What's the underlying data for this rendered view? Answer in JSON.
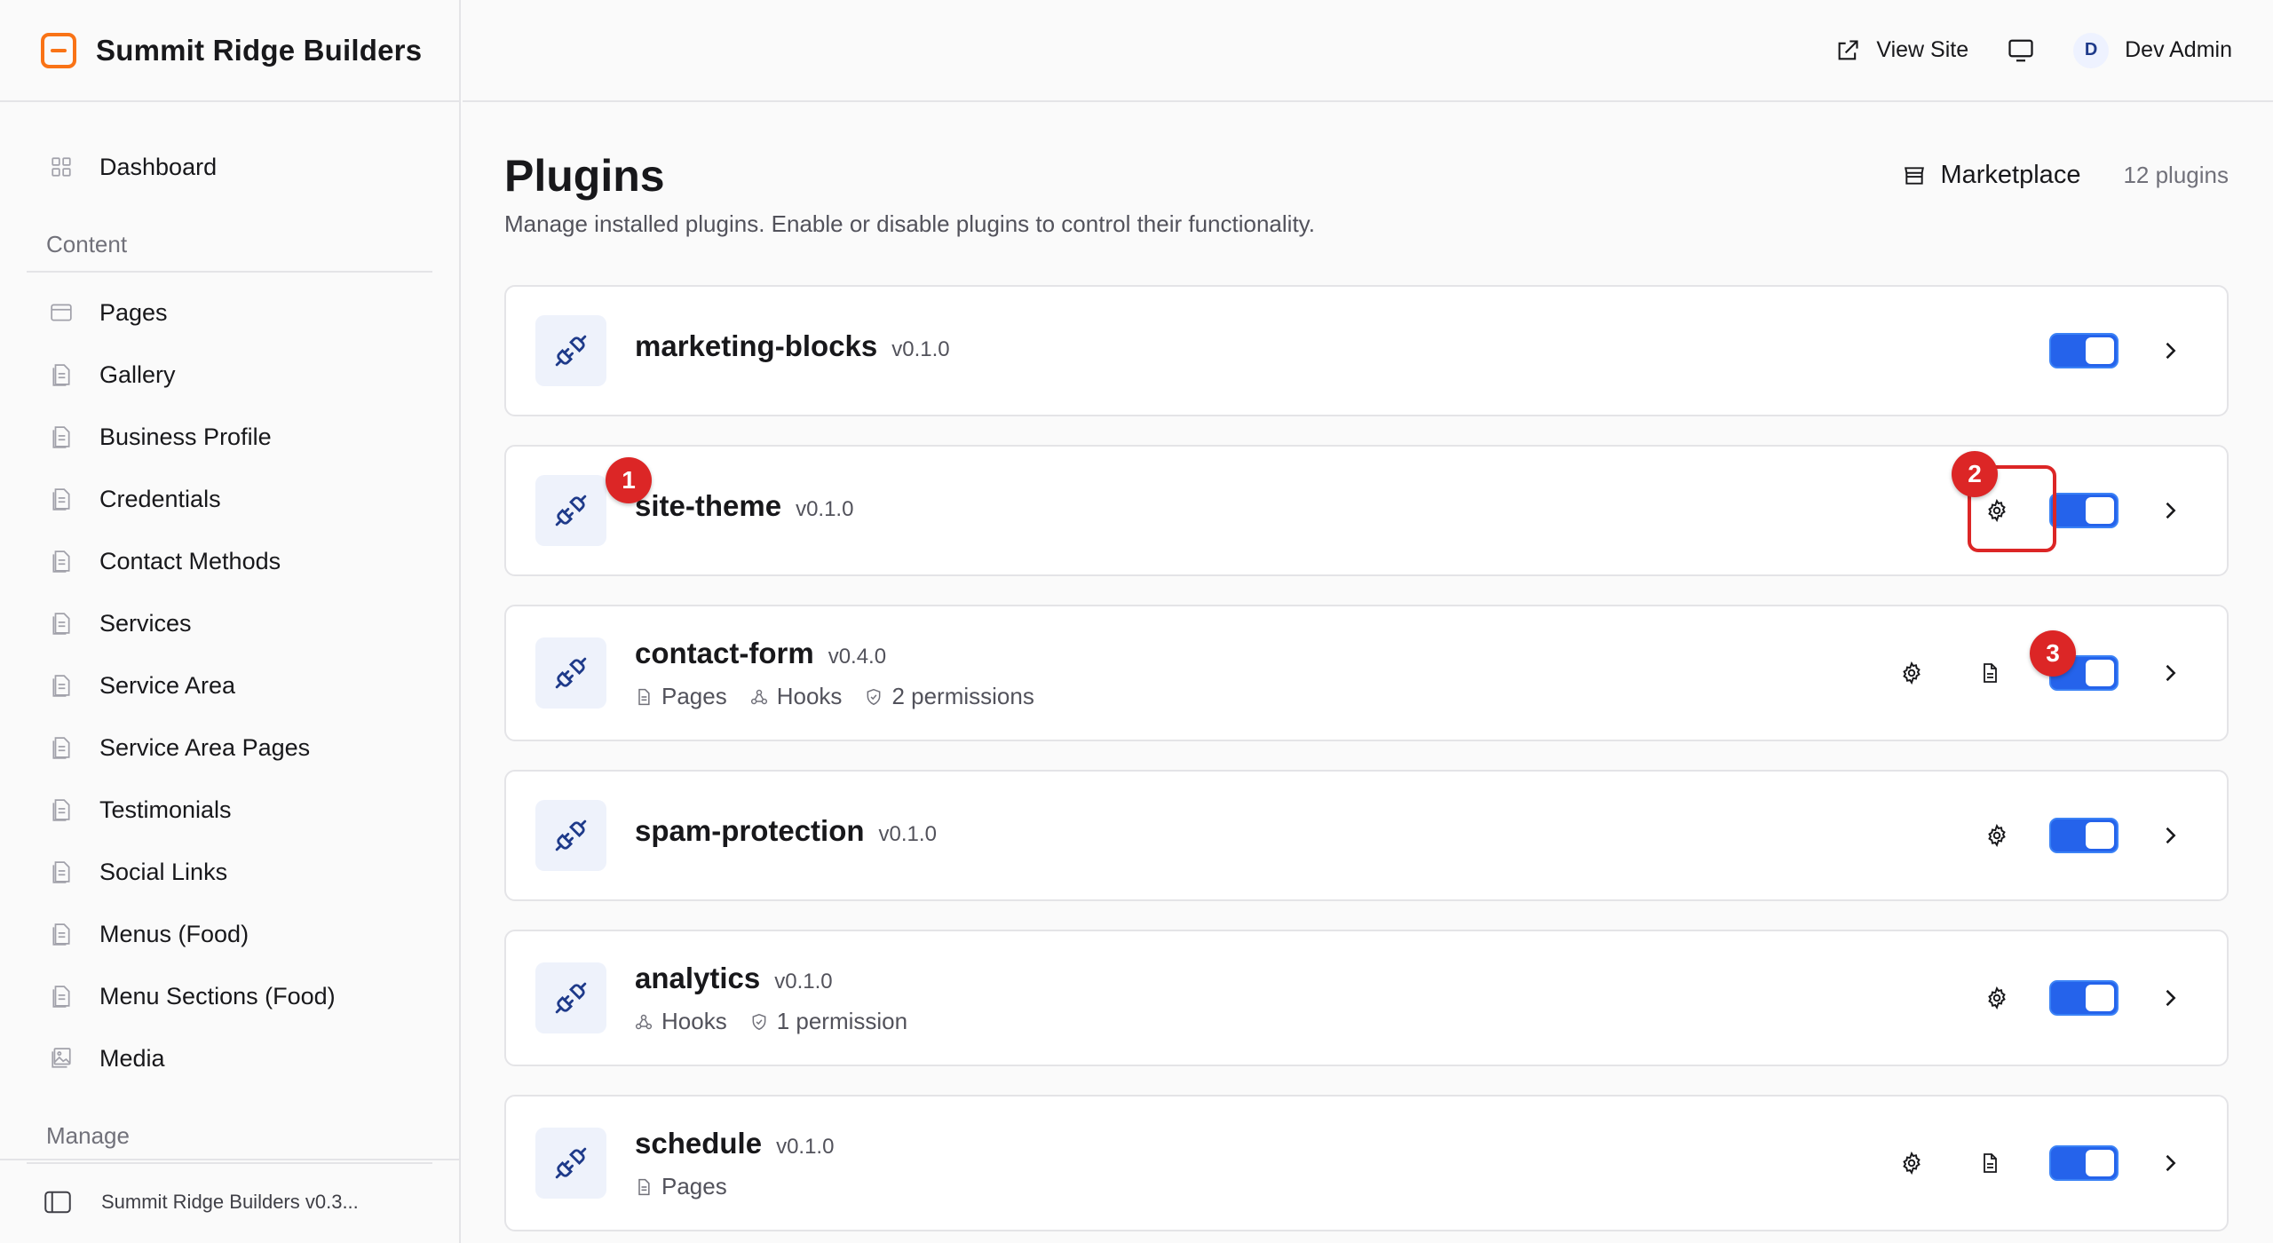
{
  "brand": {
    "name": "Summit Ridge Builders",
    "accent": "#f97316"
  },
  "header": {
    "view_site": "View Site",
    "user_initial": "D",
    "user_name": "Dev Admin"
  },
  "sidebar": {
    "dashboard": "Dashboard",
    "content_section": "Content",
    "items": [
      "Pages",
      "Gallery",
      "Business Profile",
      "Credentials",
      "Contact Methods",
      "Services",
      "Service Area",
      "Service Area Pages",
      "Testimonials",
      "Social Links",
      "Menus (Food)",
      "Menu Sections (Food)",
      "Media"
    ],
    "manage_section": "Manage",
    "footer": "Summit Ridge Builders v0.3..."
  },
  "page": {
    "title": "Plugins",
    "description": "Manage installed plugins. Enable or disable plugins to control their functionality.",
    "marketplace": "Marketplace",
    "count": "12 plugins"
  },
  "plugins": [
    {
      "name": "marketing-blocks",
      "version": "v0.1.0",
      "meta": [],
      "enabled": true
    },
    {
      "name": "site-theme",
      "version": "v0.1.0",
      "meta": [],
      "enabled": true
    },
    {
      "name": "contact-form",
      "version": "v0.4.0",
      "meta": [
        "Pages",
        "Hooks",
        "2 permissions"
      ],
      "enabled": true
    },
    {
      "name": "spam-protection",
      "version": "v0.1.0",
      "meta": [],
      "enabled": true
    },
    {
      "name": "analytics",
      "version": "v0.1.0",
      "meta": [
        "Hooks",
        "1 permission"
      ],
      "enabled": true
    },
    {
      "name": "schedule",
      "version": "v0.1.0",
      "meta": [
        "Pages"
      ],
      "enabled": true
    }
  ],
  "annotations": [
    "1",
    "2",
    "3"
  ],
  "colors": {
    "toggle_on": "#2563eb",
    "annotation": "#dc2626"
  }
}
